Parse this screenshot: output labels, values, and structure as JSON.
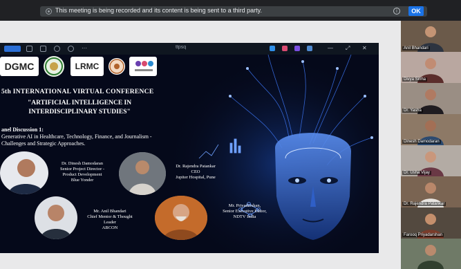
{
  "notice": {
    "message": "This meeting is being recorded and its content is being sent to a third party.",
    "ok_label": "OK"
  },
  "share": {
    "window_title": "ttpsq",
    "logos": [
      "DGMC",
      "LRMC"
    ],
    "conference_title": "5th INTERNATIONAL VIRTUAL CONFERENCE",
    "theme_line1": "\"ARTIFICIAL INTELLIGENCE IN",
    "theme_line2": "INTERDISCIPLINARY STUDIES\"",
    "panel_line1": "anel Discussion 1:",
    "panel_line2": "Generative AI in Healthcare, Technology, Finance, and Journalism -",
    "panel_line3": "Challenges and Strategic Approaches.",
    "speakers": [
      {
        "name": "Dr. Dinesh Damodaran",
        "line2": "Senior Project Director -",
        "line3": "Product Development",
        "line4": "Blue Yonder"
      },
      {
        "name": "Dr. Rajendra Patankar",
        "line2": "CEO",
        "line3": "Jupiter Hospital, Pune",
        "line4": ""
      },
      {
        "name": "Mr. Anil Bhandari",
        "line2": "Chief Mentor & Thought",
        "line3": "Leader",
        "line4": "ABCON"
      },
      {
        "name": "Mr. Priyadarshan,",
        "line2": "Senior Executive Editor,",
        "line3": "NDTV India",
        "line4": ""
      }
    ]
  },
  "gallery": {
    "participants": [
      {
        "name": "Anil Bhandari",
        "bg": "#6b5a4a",
        "skin": "#c49474",
        "shirt": "#2d3440"
      },
      {
        "name": "Divya Sinha",
        "bg": "#b9a7a0",
        "skin": "#c18c73",
        "shirt": "#5b2d2b"
      },
      {
        "name": "Dr. Yasha",
        "bg": "#9a8e84",
        "skin": "#b07a62",
        "shirt": "#1f1c20"
      },
      {
        "name": "Dinesh Damodaran",
        "bg": "#8d7966",
        "skin": "#a36f55",
        "shirt": "#2c4a70"
      },
      {
        "name": "Dr. Usha Vijay",
        "bg": "#b3aba4",
        "skin": "#c9977c",
        "shirt": "#6a3845"
      },
      {
        "name": "Dr. Rajendra Patankar",
        "bg": "#7a6452",
        "skin": "#b9876a",
        "shirt": "#e9e6e2"
      },
      {
        "name": "Farooq Priyadarshan",
        "bg": "#53493f",
        "skin": "#c48f6c",
        "shirt": "#7a3b2a"
      },
      {
        "name": "",
        "bg": "#6f7a67",
        "skin": "#b98a6d",
        "shirt": "#31402f"
      }
    ]
  }
}
